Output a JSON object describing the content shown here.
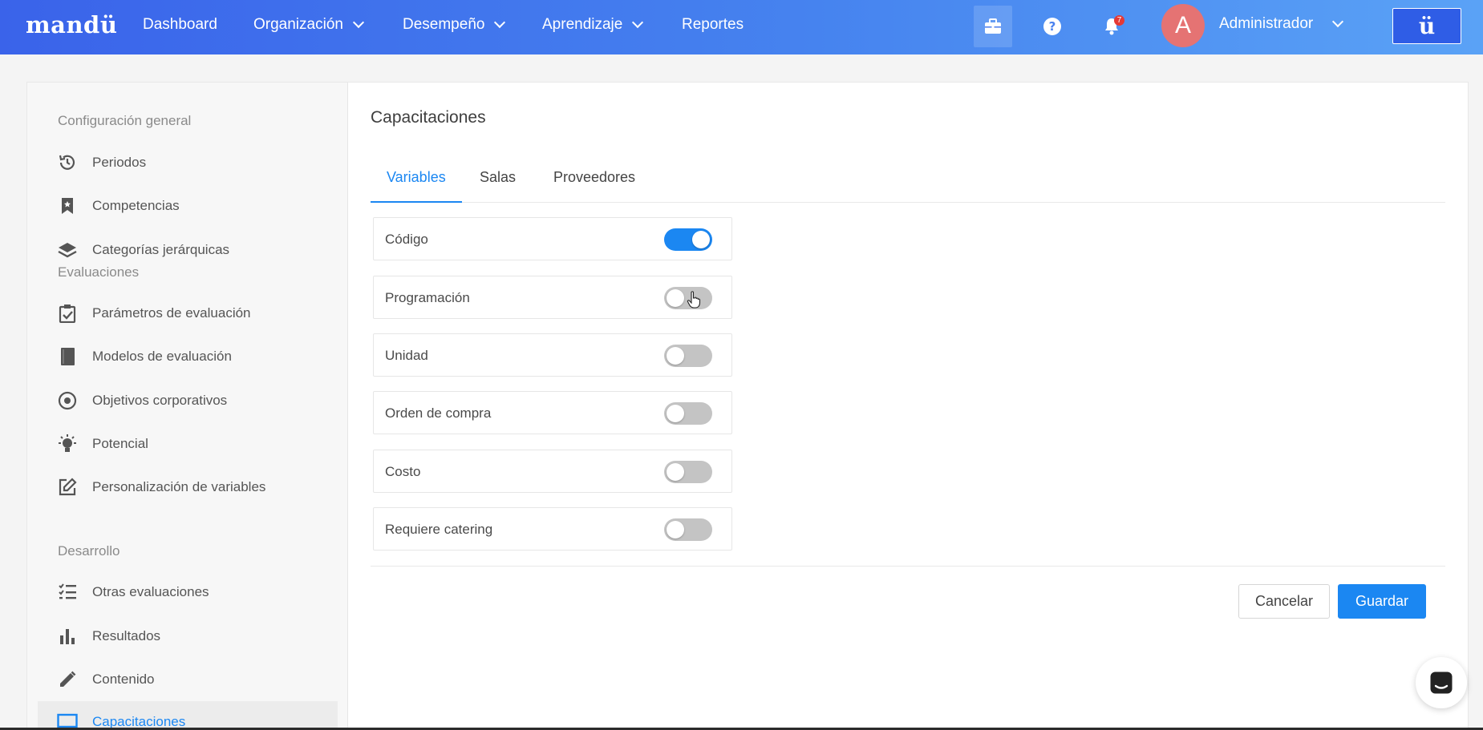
{
  "topbar": {
    "logo": "mandü",
    "nav": [
      {
        "label": "Dashboard"
      },
      {
        "label": "Organización"
      },
      {
        "label": "Desempeño"
      },
      {
        "label": "Aprendizaje"
      },
      {
        "label": "Reportes"
      }
    ],
    "notifications_count": "7",
    "avatar_initial": "A",
    "user_name": "Administrador",
    "brand_button": "ü"
  },
  "sidebar": {
    "sections": [
      {
        "label": "Configuración general"
      },
      {
        "label": "Evaluaciones"
      },
      {
        "label": "Desarrollo"
      }
    ],
    "items": [
      {
        "label": "Periodos",
        "icon": "history-icon"
      },
      {
        "label": "Competencias",
        "icon": "bookmark-star-icon"
      },
      {
        "label": "Categorías jerárquicas",
        "icon": "layers-icon"
      },
      {
        "label": "Parámetros de evaluación",
        "icon": "clipboard-check-icon"
      },
      {
        "label": "Modelos de evaluación",
        "icon": "book-icon"
      },
      {
        "label": "Objetivos corporativos",
        "icon": "target-icon"
      },
      {
        "label": "Potencial",
        "icon": "lightbulb-icon"
      },
      {
        "label": "Personalización de variables",
        "icon": "edit-icon"
      },
      {
        "label": "Otras evaluaciones",
        "icon": "checklist-icon"
      },
      {
        "label": "Resultados",
        "icon": "bar-chart-icon"
      },
      {
        "label": "Contenido",
        "icon": "pencil-icon"
      },
      {
        "label": "Capacitaciones",
        "icon": "monitor-icon"
      }
    ],
    "active_item": "Capacitaciones"
  },
  "main": {
    "title": "Capacitaciones",
    "tabs": [
      {
        "label": "Variables"
      },
      {
        "label": "Salas"
      },
      {
        "label": "Proveedores"
      }
    ],
    "active_tab": "Variables",
    "variables": [
      {
        "label": "Código",
        "enabled": true
      },
      {
        "label": "Programación",
        "enabled": false
      },
      {
        "label": "Unidad",
        "enabled": false
      },
      {
        "label": "Orden de compra",
        "enabled": false
      },
      {
        "label": "Costo",
        "enabled": false
      },
      {
        "label": "Requiere catering",
        "enabled": false
      }
    ],
    "cancel_label": "Cancelar",
    "save_label": "Guardar"
  },
  "colors": {
    "accent": "#1b87f2",
    "topbar_start": "#3a63ea",
    "topbar_end": "#5aa2f6",
    "toggle_off": "#c4c4c4",
    "badge": "#e53935",
    "avatar": "#e57373"
  }
}
